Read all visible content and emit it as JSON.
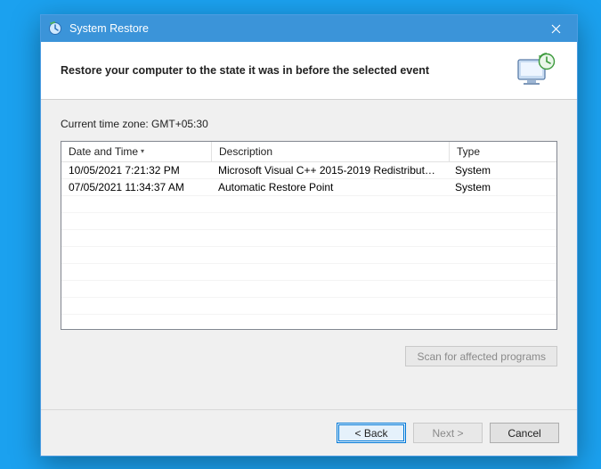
{
  "titlebar": {
    "title": "System Restore"
  },
  "header": {
    "heading": "Restore your computer to the state it was in before the selected event"
  },
  "body": {
    "timezone_label": "Current time zone: GMT+05:30",
    "columns": {
      "date": "Date and Time",
      "desc": "Description",
      "type": "Type"
    },
    "rows": [
      {
        "date": "10/05/2021 7:21:32 PM",
        "desc": "Microsoft Visual C++ 2015-2019 Redistributable ...",
        "type": "System"
      },
      {
        "date": "07/05/2021 11:34:37 AM",
        "desc": "Automatic Restore Point",
        "type": "System"
      }
    ]
  },
  "buttons": {
    "scan": "Scan for affected programs",
    "back": "< Back",
    "next": "Next >",
    "cancel": "Cancel"
  }
}
